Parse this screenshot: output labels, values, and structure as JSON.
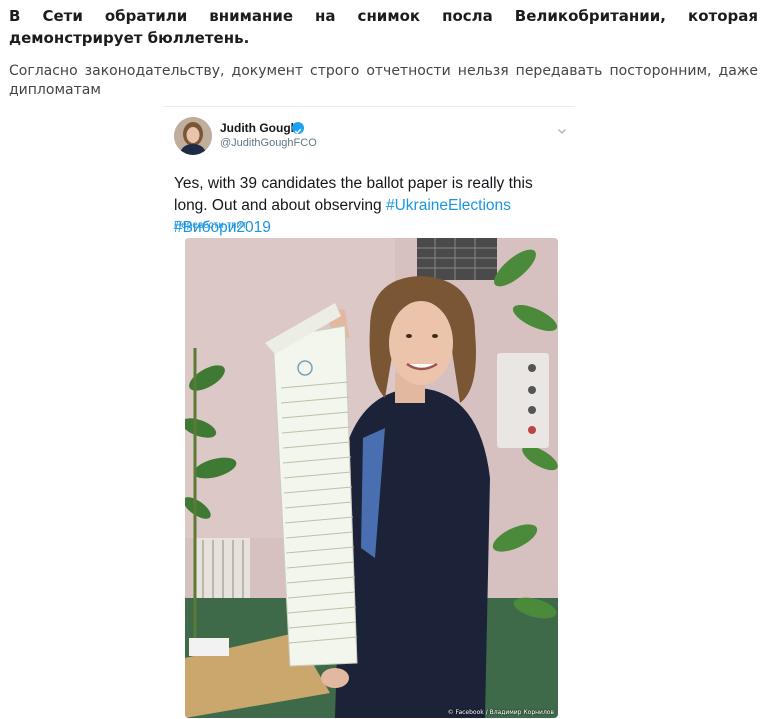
{
  "article": {
    "headline": "В Сети обратили внимание на снимок посла Великобритании, которая демонстрирует бюллетень.",
    "lead": "Согласно законодательству, документ строго отчетности нельзя передавать посторонним, даже дипломатам"
  },
  "tweet": {
    "author_name": "Judith Gough",
    "author_handle": "@JudithGoughFCO",
    "verified_icon": "verified-check-icon",
    "menu_icon": "chevron-down-icon",
    "text_part1": "Yes, with 39 candidates the ballot paper is really this long.  Out and about observing ",
    "hashtag1": "#UkraineElections",
    "text_space": " ",
    "hashtag2": "#Вибори2019",
    "translate_label": "Перевести твит",
    "photo_credit": "© Facebook / Владимир Корнилов",
    "colors": {
      "link": "#1b95e0",
      "verified": "#1da1f2",
      "handle": "#657786"
    }
  }
}
